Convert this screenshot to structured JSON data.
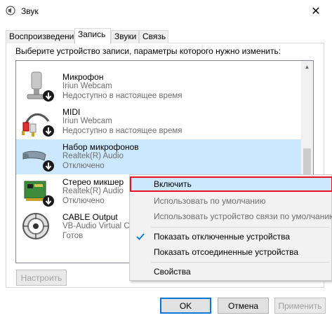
{
  "window": {
    "title": "Звук",
    "close_glyph": "✕"
  },
  "tabs": [
    {
      "label": "Воспроизведение",
      "active": false
    },
    {
      "label": "Запись",
      "active": true
    },
    {
      "label": "Звуки",
      "active": false
    },
    {
      "label": "Связь",
      "active": false
    }
  ],
  "instruction": "Выберите устройство записи, параметры которого нужно изменить:",
  "devices": [
    {
      "name": "Микрофон",
      "driver": "Iriun Webcam",
      "status": "Недоступно в настоящее время",
      "icon": "microphone-stand-icon",
      "selected": false
    },
    {
      "name": "MIDI",
      "driver": "Iriun Webcam",
      "status": "Недоступно в настоящее время",
      "icon": "rca-cable-icon",
      "selected": false
    },
    {
      "name": "Набор микрофонов",
      "driver": "Realtek(R) Audio",
      "status": "Отключено",
      "icon": "microphone-array-icon",
      "selected": true
    },
    {
      "name": "Стерео микшер",
      "driver": "Realtek(R) Audio",
      "status": "Отключено",
      "icon": "sound-card-icon",
      "selected": false
    },
    {
      "name": "CABLE Output",
      "driver": "VB-Audio Virtual C",
      "status": "Готов",
      "icon": "cable-reel-icon",
      "selected": false
    }
  ],
  "buttons": {
    "configure": "Настроить",
    "ok": "OK",
    "cancel": "Отмена",
    "apply": "Применить"
  },
  "context_menu": {
    "enable": "Включить",
    "set_default": "Использовать по умолчанию",
    "set_default_comm": "Использовать устройство связи по умолчанию",
    "show_disabled": "Показать отключенные устройства",
    "show_disconnected": "Показать отсоединенные устройства",
    "properties": "Свойства"
  },
  "colors": {
    "selection": "#cce8ff",
    "highlight_border": "#e81123",
    "accent": "#0078d7"
  }
}
